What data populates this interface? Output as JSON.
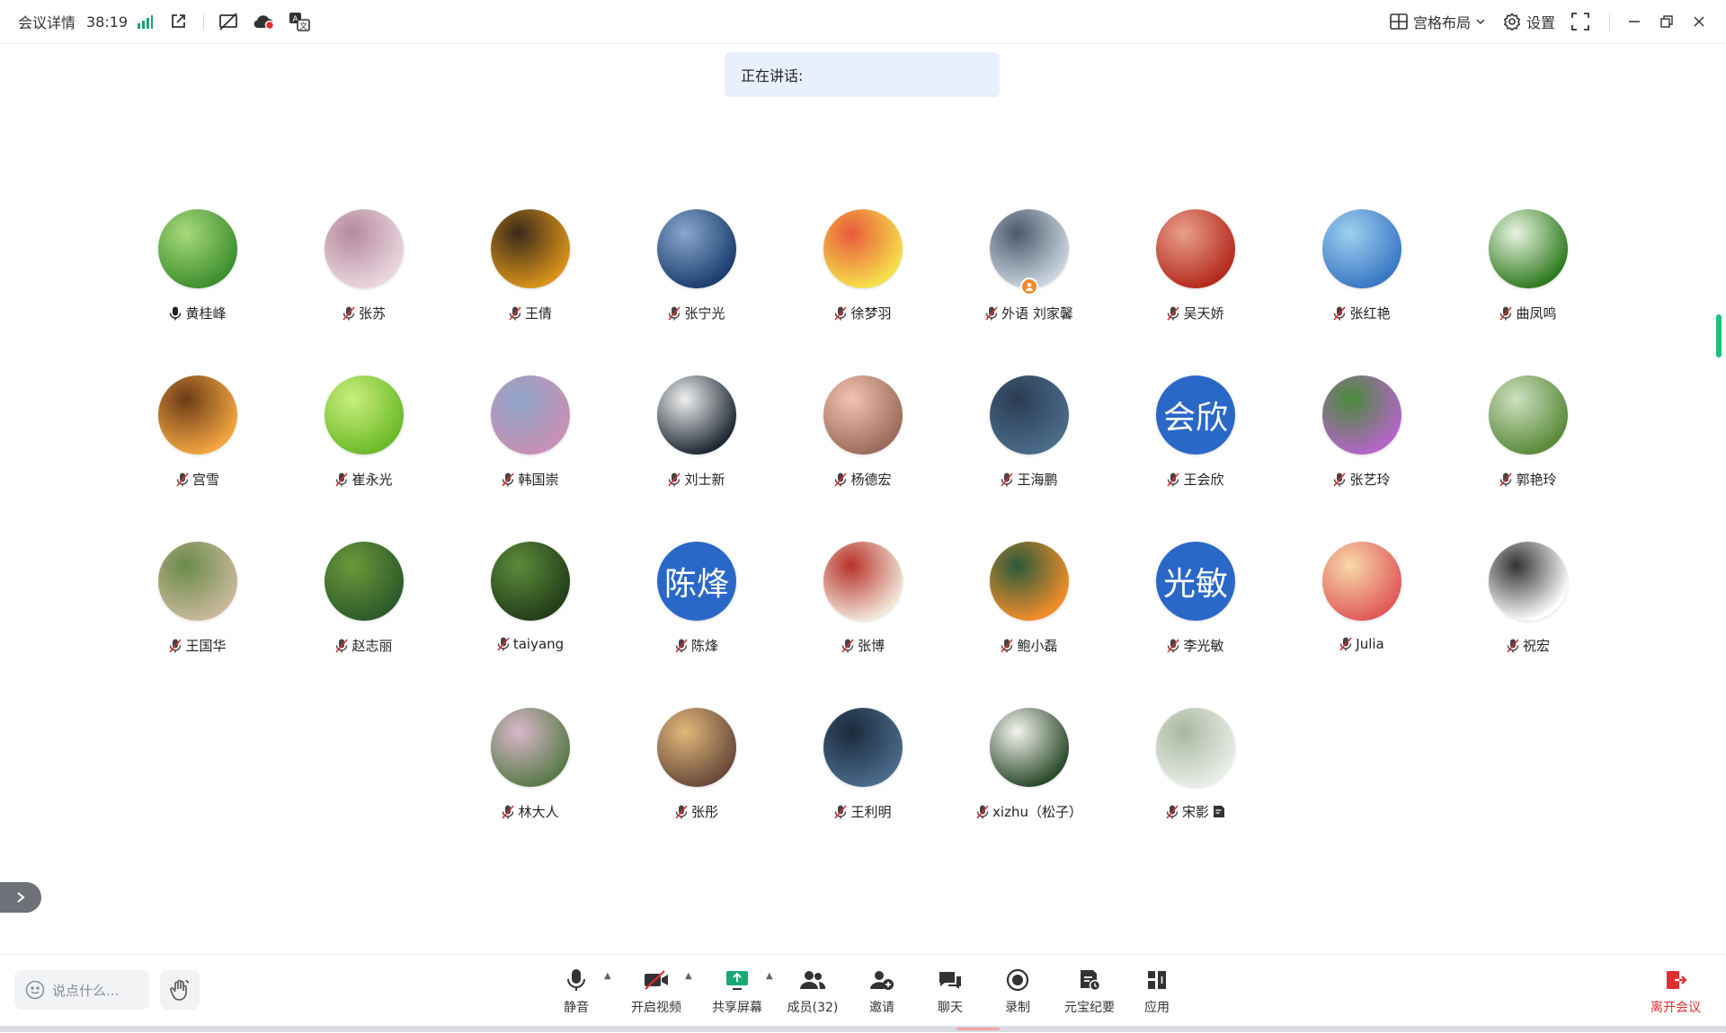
{
  "topbar": {
    "meeting_details": "会议详情",
    "timer": "38:19",
    "layout_label": "宫格布局",
    "settings_label": "设置"
  },
  "speaking": {
    "label": "正在讲话:"
  },
  "participants": [
    {
      "name": "黄桂峰",
      "mic": "on"
    },
    {
      "name": "张苏",
      "mic": "muted"
    },
    {
      "name": "王倩",
      "mic": "muted"
    },
    {
      "name": "张宁光",
      "mic": "muted"
    },
    {
      "name": "徐梦羽",
      "mic": "muted"
    },
    {
      "name": "外语 刘家馨",
      "mic": "muted",
      "host": true
    },
    {
      "name": "吴天娇",
      "mic": "muted"
    },
    {
      "name": "张红艳",
      "mic": "muted"
    },
    {
      "name": "曲凤鸣",
      "mic": "muted"
    },
    {
      "name": "宫雪",
      "mic": "muted"
    },
    {
      "name": "崔永光",
      "mic": "muted"
    },
    {
      "name": "韩国崇",
      "mic": "muted"
    },
    {
      "name": "刘士新",
      "mic": "muted"
    },
    {
      "name": "杨德宏",
      "mic": "muted"
    },
    {
      "name": "王海鹏",
      "mic": "muted"
    },
    {
      "name": "王会欣",
      "mic": "muted",
      "initials": "会欣"
    },
    {
      "name": "张艺玲",
      "mic": "muted"
    },
    {
      "name": "郭艳玲",
      "mic": "muted"
    },
    {
      "name": "王国华",
      "mic": "muted"
    },
    {
      "name": "赵志丽",
      "mic": "muted"
    },
    {
      "name": "taiyang",
      "mic": "muted"
    },
    {
      "name": "陈烽",
      "mic": "muted",
      "initials": "陈烽"
    },
    {
      "name": "张博",
      "mic": "muted"
    },
    {
      "name": "鲍小磊",
      "mic": "muted"
    },
    {
      "name": "李光敏",
      "mic": "muted",
      "initials": "光敏"
    },
    {
      "name": "Julia",
      "mic": "muted"
    },
    {
      "name": "祝宏",
      "mic": "muted"
    },
    {
      "name": "林大人",
      "mic": "muted"
    },
    {
      "name": "张彤",
      "mic": "muted"
    },
    {
      "name": "王利明",
      "mic": "muted"
    },
    {
      "name": "xizhu（松子）",
      "mic": "muted"
    },
    {
      "name": "宋影",
      "mic": "muted",
      "note_icon": true
    }
  ],
  "chat": {
    "placeholder": "说点什么..."
  },
  "toolbar": {
    "mute": "静音",
    "video": "开启视频",
    "share": "共享屏幕",
    "members": "成员(32)",
    "invite": "邀请",
    "chat": "聊天",
    "record": "录制",
    "minutes": "元宝纪要",
    "apps": "应用",
    "leave": "离开会议"
  },
  "colors": {
    "accent": "#2a68c8",
    "speaking_bg": "#e9f0fd",
    "leave": "#e02e2e",
    "share_icon": "#19a974",
    "signal": "#19a974"
  }
}
